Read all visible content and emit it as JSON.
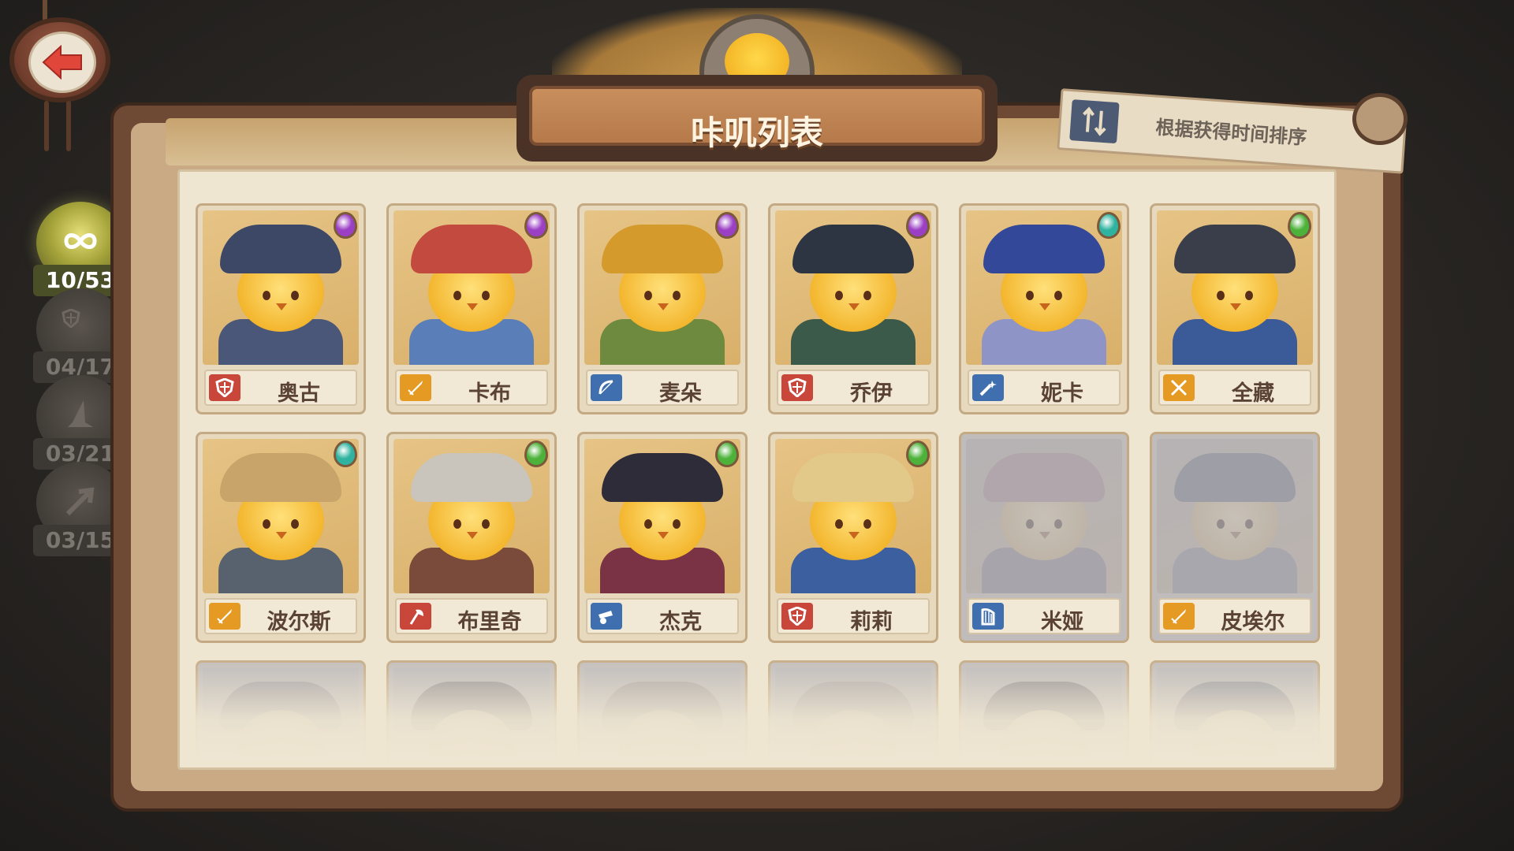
{
  "header": {
    "title": "咔叽列表"
  },
  "sort": {
    "label": "根据获得时间排序",
    "icon": "sort-arrows-icon"
  },
  "side_filters": [
    {
      "icon": "infinity-icon",
      "count": "10/53",
      "active": true
    },
    {
      "icon": "shield-icon",
      "count": "04/17",
      "active": false
    },
    {
      "icon": "wizard-hat-icon",
      "count": "03/21",
      "active": false
    },
    {
      "icon": "arrow-icon",
      "count": "03/15",
      "active": false
    }
  ],
  "cards": [
    {
      "name": "奥古",
      "class_icon": "shield-icon",
      "class_color": "#c8463a",
      "gem": "#9b3fc4",
      "hat": "#3c4866",
      "body": "#4a5778",
      "locked": false
    },
    {
      "name": "卡布",
      "class_icon": "sword-icon",
      "class_color": "#e59a24",
      "gem": "#9b3fc4",
      "hat": "#c24a3e",
      "body": "#5a7fb8",
      "locked": false
    },
    {
      "name": "麦朵",
      "class_icon": "bow-icon",
      "class_color": "#3f6fae",
      "gem": "#9b3fc4",
      "hat": "#d59a2c",
      "body": "#6d8a3e",
      "locked": false
    },
    {
      "name": "乔伊",
      "class_icon": "shield-icon",
      "class_color": "#c8463a",
      "gem": "#9b3fc4",
      "hat": "#2d3442",
      "body": "#3c5a4a",
      "locked": false
    },
    {
      "name": "妮卡",
      "class_icon": "wand-icon",
      "class_color": "#3f6fae",
      "gem": "#2fb3a0",
      "hat": "#34489a",
      "body": "#8e94c6",
      "locked": false
    },
    {
      "name": "全藏",
      "class_icon": "crossed-swords-icon",
      "class_color": "#e59a24",
      "gem": "#4db23a",
      "hat": "#3a3d4a",
      "body": "#3b5a98",
      "locked": false
    },
    {
      "name": "波尔斯",
      "class_icon": "sword-icon",
      "class_color": "#e59a24",
      "gem": "#2fb3a0",
      "hat": "#c9a46a",
      "body": "#58626e",
      "locked": false
    },
    {
      "name": "布里奇",
      "class_icon": "axe-icon",
      "class_color": "#c8463a",
      "gem": "#4db23a",
      "hat": "#c9c4bc",
      "body": "#7a4a3a",
      "locked": false
    },
    {
      "name": "杰克",
      "class_icon": "cannon-icon",
      "class_color": "#3f6fae",
      "gem": "#4db23a",
      "hat": "#2f2c3a",
      "body": "#7a3344",
      "locked": false
    },
    {
      "name": "莉莉",
      "class_icon": "shield-icon",
      "class_color": "#c8463a",
      "gem": "#4db23a",
      "hat": "#e2c98a",
      "body": "#3c5fa0",
      "locked": false
    },
    {
      "name": "米娅",
      "class_icon": "harp-icon",
      "class_color": "#3f6fae",
      "gem": "",
      "hat": "#c07a8e",
      "body": "#8a7aa0",
      "locked": true
    },
    {
      "name": "皮埃尔",
      "class_icon": "sword-icon",
      "class_color": "#e59a24",
      "gem": "",
      "hat": "#5a6a9a",
      "body": "#7a8aa8",
      "locked": true
    }
  ],
  "partial_cards": [
    {
      "hat": "#6a6a8a"
    },
    {
      "hat": "#3a3644"
    },
    {
      "hat": "#8a7a6a"
    },
    {
      "hat": "#9a8a7a"
    },
    {
      "hat": "#2f3444"
    },
    {
      "hat": "#3a4a8a"
    }
  ],
  "colors": {
    "accent_gold": "#f2b425",
    "board_brown": "#6e4a34",
    "paper": "#efe6d2"
  }
}
